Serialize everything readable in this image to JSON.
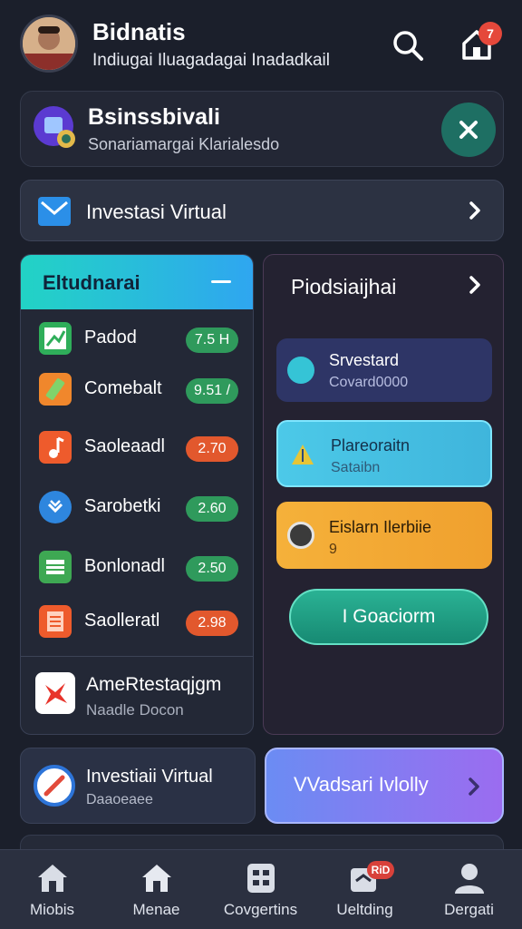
{
  "header": {
    "title": "Bidnatis",
    "subtitle": "Indiugai Iluagadagai  Inadadkail",
    "notification_badge": "7"
  },
  "top_card": {
    "title": "Bsinssbivali",
    "subtitle": "Sonariamargai Klarialesdo"
  },
  "investasi_row": {
    "label": "Investasi Virtual"
  },
  "left_panel": {
    "header": "Eltudnarai",
    "items": [
      {
        "name": "Padod",
        "value": "7.5 Н",
        "icon_color": "#2fae5a",
        "pill_color": "#2f9a5c"
      },
      {
        "name": "Comebalt",
        "value": "9.51 /",
        "icon_color": "#f0872c",
        "pill_color": "#2f9a5c"
      },
      {
        "name": "Saoleaadl",
        "value": "2.70",
        "icon_color": "#ee5b2c",
        "pill_color": "#e2582d"
      },
      {
        "name": "Sarobetki",
        "value": "2.60",
        "icon_color": "#2e86de",
        "pill_color": "#2f9a5c"
      },
      {
        "name": "Bonlonadl",
        "value": "2.50",
        "icon_color": "#3ea853",
        "pill_color": "#2f9a5c"
      },
      {
        "name": "Saolleratl",
        "value": "2.98",
        "icon_color": "#ee5b2c",
        "pill_color": "#e2582d"
      }
    ],
    "footer_title": "AmeRtestaqjgm",
    "footer_subtitle": "Naadle Docon"
  },
  "right_panel": {
    "title": "Piodsiaijhai",
    "cards": [
      {
        "title": "Srvestard",
        "subtitle": "Covard0000"
      },
      {
        "title": "Plareoraitn",
        "subtitle": "Sataibn"
      },
      {
        "title": "Eislarn Ilerbiie",
        "subtitle": "9"
      }
    ],
    "button_label": "I  Goaciorm"
  },
  "bottom_left": {
    "title": "Investiaii Virtual",
    "subtitle": "Daaoeaee"
  },
  "bottom_right": {
    "label": "VVadsari Ivlolly"
  },
  "nav": {
    "items": [
      {
        "label": "Miobis",
        "icon": "home-icon"
      },
      {
        "label": "Menae",
        "icon": "home-icon"
      },
      {
        "label": "Covgertins",
        "icon": "grid-icon"
      },
      {
        "label": "Ueltding",
        "icon": "inbox-icon",
        "badge": "RiD"
      },
      {
        "label": "Dergati",
        "icon": "user-icon"
      }
    ]
  },
  "colors": {
    "background": "#1b1f2b",
    "accent_teal": "#1e6f63",
    "accent_cyan": "#22d3c5",
    "accent_purple": "#9b6cf0"
  }
}
